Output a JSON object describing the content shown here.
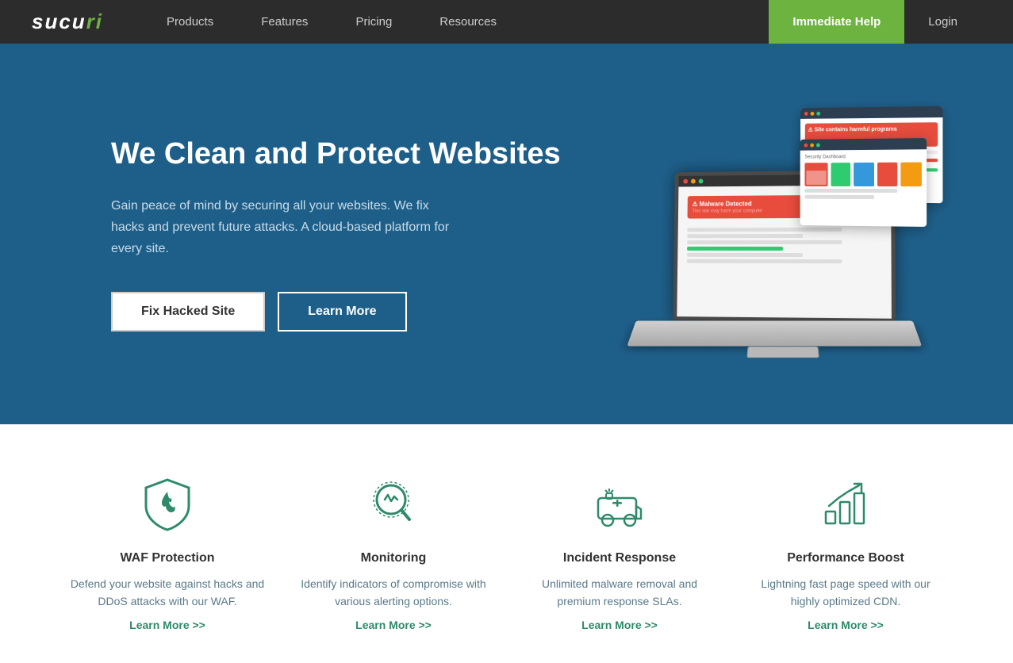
{
  "brand": {
    "name_white": "sucu",
    "name_green": "ri",
    "name_italic": "sucuri"
  },
  "navbar": {
    "products_label": "Products",
    "features_label": "Features",
    "pricing_label": "Pricing",
    "resources_label": "Resources",
    "immediate_help_label": "Immediate Help",
    "login_label": "Login"
  },
  "hero": {
    "title": "We Clean and Protect Websites",
    "description": "Gain peace of mind by securing all your websites. We fix hacks and prevent future attacks. A cloud-based platform for every site.",
    "fix_button": "Fix Hacked Site",
    "learn_button": "Learn More"
  },
  "features": [
    {
      "id": "waf",
      "icon_name": "shield-fire-icon",
      "title": "WAF Protection",
      "description": "Defend your website against hacks and DDoS attacks with our WAF.",
      "link": "Learn More >>"
    },
    {
      "id": "monitoring",
      "icon_name": "monitoring-icon",
      "title": "Monitoring",
      "description": "Identify indicators of compromise with various alerting options.",
      "link": "Learn More >>"
    },
    {
      "id": "incident",
      "icon_name": "incident-response-icon",
      "title": "Incident Response",
      "description": "Unlimited malware removal and premium response SLAs.",
      "link": "Learn More >>"
    },
    {
      "id": "performance",
      "icon_name": "performance-boost-icon",
      "title": "Performance Boost",
      "description": "Lightning fast page speed with our highly optimized CDN.",
      "link": "Learn More >>"
    }
  ],
  "colors": {
    "accent_green": "#6db33f",
    "feature_teal": "#2e8a6a",
    "nav_bg": "#2c2c2c",
    "hero_bg": "#1e5f8a"
  }
}
